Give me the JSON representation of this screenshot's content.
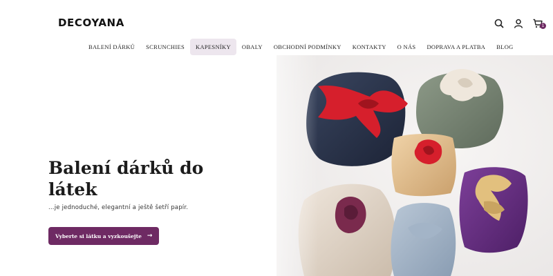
{
  "brand": {
    "logo": "DECOYANA",
    "accent_color": "#6e2a63"
  },
  "header": {
    "icons": [
      "search-icon",
      "user-icon",
      "cart-icon"
    ],
    "cart_count": "1"
  },
  "nav": {
    "items": [
      {
        "label": "BALENÍ DÁRKŮ",
        "active": false
      },
      {
        "label": "SCRUNCHIES",
        "active": false
      },
      {
        "label": "KAPESNÍKY",
        "active": true
      },
      {
        "label": "OBALY",
        "active": false
      },
      {
        "label": "OBCHODNÍ PODMÍNKY",
        "active": false
      },
      {
        "label": "KONTAKTY",
        "active": false
      },
      {
        "label": "O NÁS",
        "active": false
      },
      {
        "label": "DOPRAVA A PLATBA",
        "active": false
      },
      {
        "label": "BLOG",
        "active": false
      }
    ]
  },
  "hero": {
    "title": "Balení dárků do látek",
    "subtitle": "...je jednoduché, elegantní a ještě šetří papír.",
    "cta_label": "Vyberte si látku a vyzkoušejte",
    "cta_icon": "arrow-right-icon",
    "image": "fabric-wrapped-gifts-photo"
  }
}
